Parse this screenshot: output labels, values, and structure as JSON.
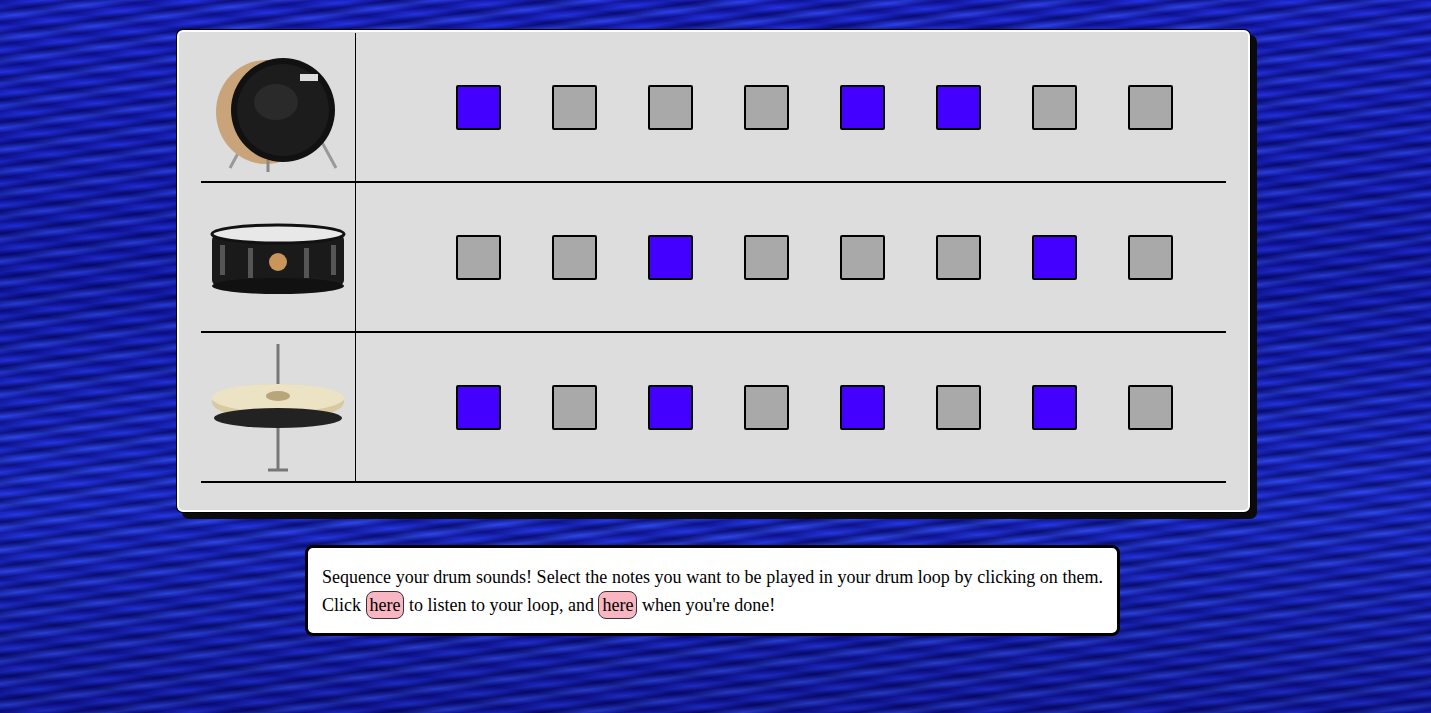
{
  "tracks": [
    {
      "kind": "bass-drum",
      "steps": [
        {
          "on": true
        },
        {
          "on": false
        },
        {
          "on": false
        },
        {
          "on": false
        },
        {
          "on": true
        },
        {
          "on": true
        },
        {
          "on": false
        },
        {
          "on": false
        }
      ]
    },
    {
      "kind": "snare",
      "steps": [
        {
          "on": false
        },
        {
          "on": false
        },
        {
          "on": true
        },
        {
          "on": false
        },
        {
          "on": false
        },
        {
          "on": false
        },
        {
          "on": true
        },
        {
          "on": false
        }
      ]
    },
    {
      "kind": "hi-hat",
      "steps": [
        {
          "on": true
        },
        {
          "on": false
        },
        {
          "on": true
        },
        {
          "on": false
        },
        {
          "on": true
        },
        {
          "on": false
        },
        {
          "on": true
        },
        {
          "on": false
        }
      ]
    }
  ],
  "instructions": {
    "text_before": "Sequence your drum sounds! Select the notes you want to be played in your drum loop by clicking on them. Click ",
    "play_button": "here",
    "text_middle": " to listen to your loop, and ",
    "done_button": "here",
    "text_after": " when you're done!"
  }
}
